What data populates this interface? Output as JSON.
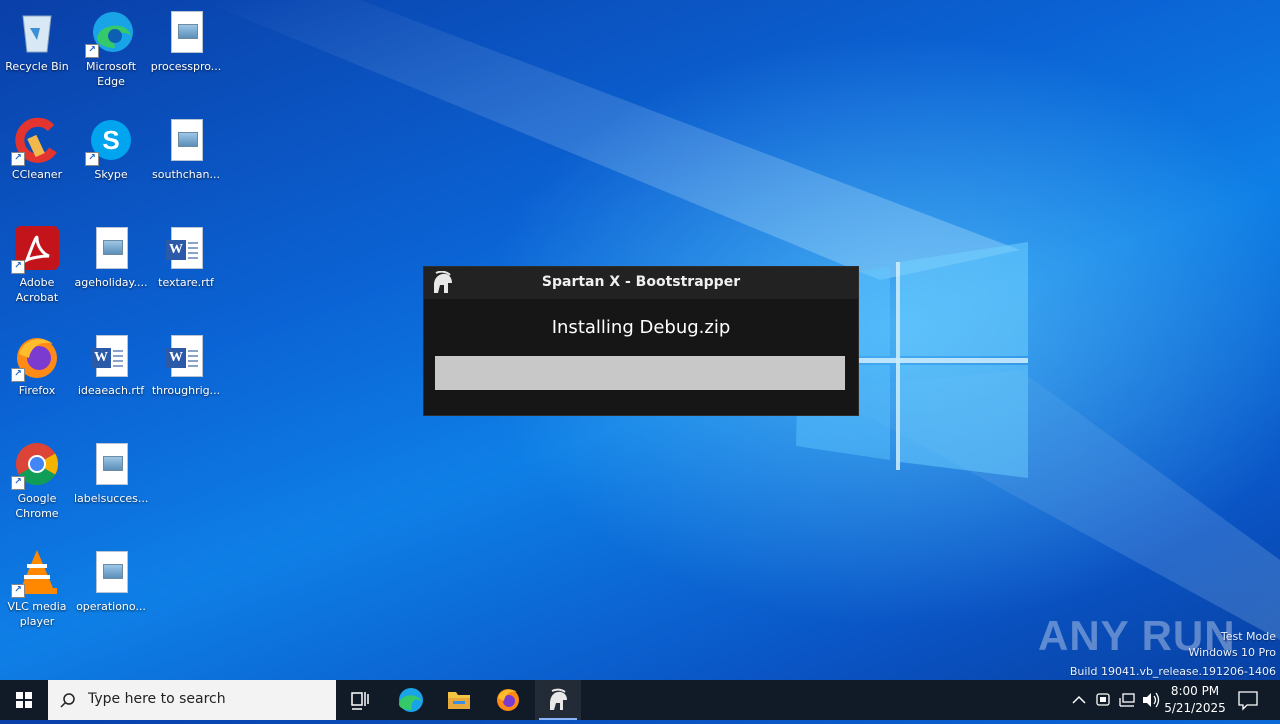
{
  "desktop": {
    "icons": [
      {
        "label": "Recycle Bin",
        "icon": "recycle-bin-icon"
      },
      {
        "label": "Microsoft Edge",
        "icon": "edge-icon"
      },
      {
        "label": "processpro...",
        "icon": "image-file-icon"
      },
      {
        "label": "CCleaner",
        "icon": "ccleaner-icon"
      },
      {
        "label": "Skype",
        "icon": "skype-icon"
      },
      {
        "label": "southchan...",
        "icon": "image-file-icon"
      },
      {
        "label": "Adobe Acrobat",
        "icon": "acrobat-icon"
      },
      {
        "label": "ageholiday....",
        "icon": "image-file-icon"
      },
      {
        "label": "textare.rtf",
        "icon": "word-doc-icon"
      },
      {
        "label": "Firefox",
        "icon": "firefox-icon"
      },
      {
        "label": "ideaeach.rtf",
        "icon": "word-doc-icon"
      },
      {
        "label": "throughrig...",
        "icon": "word-doc-icon"
      },
      {
        "label": "Google Chrome",
        "icon": "chrome-icon"
      },
      {
        "label": "labelsucces...",
        "icon": "image-file-icon"
      },
      {
        "label": "VLC media player",
        "icon": "vlc-icon"
      },
      {
        "label": "operationo...",
        "icon": "image-file-icon"
      }
    ]
  },
  "dialog": {
    "title": "Spartan X - Bootstrapper",
    "message": "Installing Debug.zip",
    "progress_fraction": 0
  },
  "watermark": {
    "brand": "ANY RUN",
    "line1": "Test Mode",
    "line2": "Windows 10 Pro",
    "line3": "Build 19041.vb_release.191206-1406"
  },
  "taskbar": {
    "search_placeholder": "Type here to search",
    "time": "8:00 PM",
    "date": "5/21/2025"
  },
  "colors": {
    "dialog_bg": "#161616",
    "titlebar_bg": "#222222",
    "progress_track": "#c8c8c8",
    "taskbar_bg": "#111a27"
  }
}
